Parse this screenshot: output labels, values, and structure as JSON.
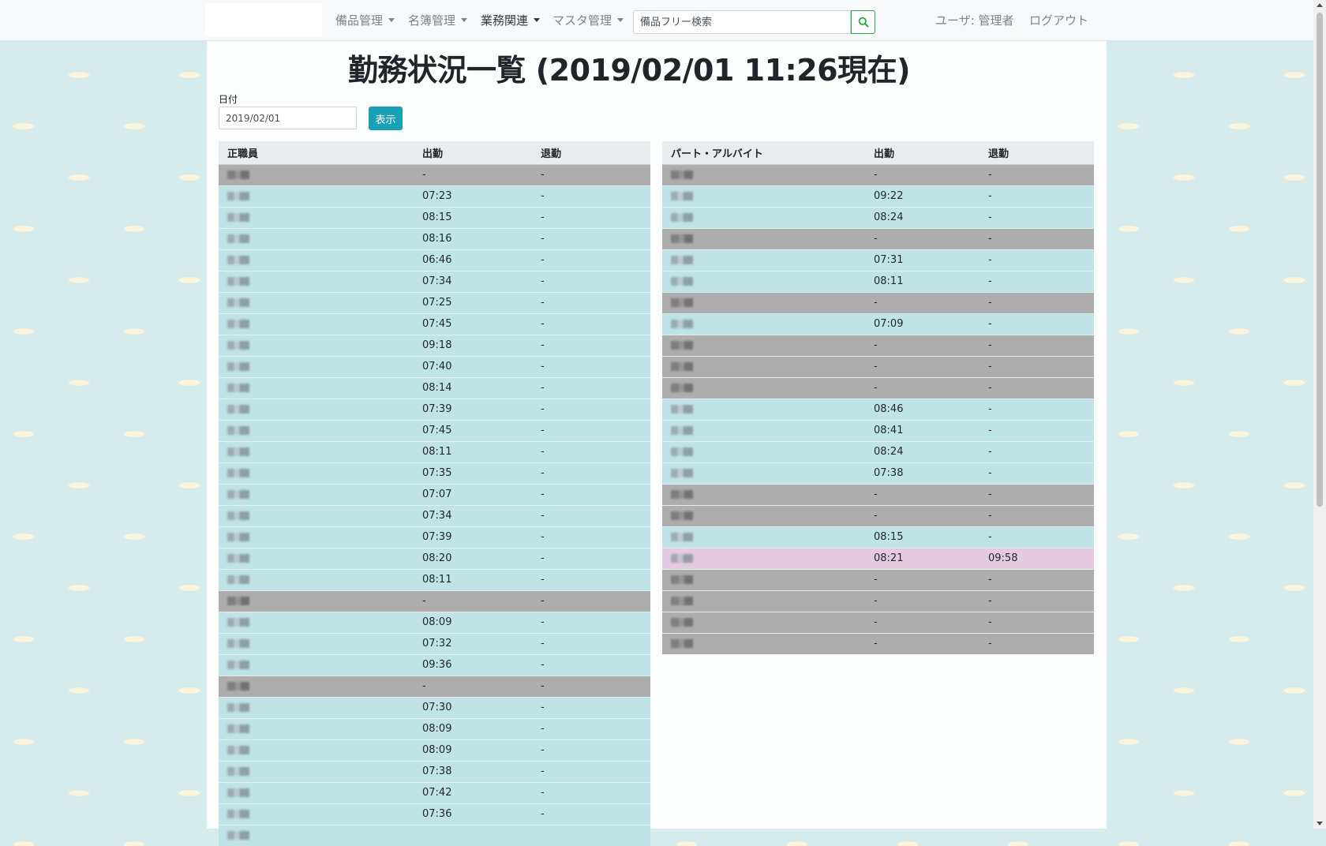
{
  "navbar": {
    "menus": [
      "備品管理",
      "名簿管理",
      "業務関連",
      "マスタ管理"
    ],
    "active_menu": "業務関連",
    "search_placeholder": "備品フリー検索",
    "user": "ユーザ: 管理者",
    "logout": "ログアウト"
  },
  "page": {
    "title": "勤務状況一覧 (2019/02/01 11:26現在)",
    "date_label": "日付",
    "date_value": "2019/02/01",
    "show_button": "表示"
  },
  "colors": {
    "working": "#c0e3e8",
    "absent": "#adadad",
    "left_work": "#e6cae1",
    "button": "#17a2b8"
  },
  "regular": {
    "headers": [
      "正職員",
      "出勤",
      "退勤"
    ],
    "rows": [
      {
        "in": "-",
        "out": "-",
        "status": "absent"
      },
      {
        "in": "07:23",
        "out": "-",
        "status": "in"
      },
      {
        "in": "08:15",
        "out": "-",
        "status": "in"
      },
      {
        "in": "08:16",
        "out": "-",
        "status": "in"
      },
      {
        "in": "06:46",
        "out": "-",
        "status": "in"
      },
      {
        "in": "07:34",
        "out": "-",
        "status": "in"
      },
      {
        "in": "07:25",
        "out": "-",
        "status": "in"
      },
      {
        "in": "07:45",
        "out": "-",
        "status": "in"
      },
      {
        "in": "09:18",
        "out": "-",
        "status": "in"
      },
      {
        "in": "07:40",
        "out": "-",
        "status": "in"
      },
      {
        "in": "08:14",
        "out": "-",
        "status": "in"
      },
      {
        "in": "07:39",
        "out": "-",
        "status": "in"
      },
      {
        "in": "07:45",
        "out": "-",
        "status": "in"
      },
      {
        "in": "08:11",
        "out": "-",
        "status": "in"
      },
      {
        "in": "07:35",
        "out": "-",
        "status": "in"
      },
      {
        "in": "07:07",
        "out": "-",
        "status": "in"
      },
      {
        "in": "07:34",
        "out": "-",
        "status": "in"
      },
      {
        "in": "07:39",
        "out": "-",
        "status": "in"
      },
      {
        "in": "08:20",
        "out": "-",
        "status": "in"
      },
      {
        "in": "08:11",
        "out": "-",
        "status": "in"
      },
      {
        "in": "-",
        "out": "-",
        "status": "absent"
      },
      {
        "in": "08:09",
        "out": "-",
        "status": "in"
      },
      {
        "in": "07:32",
        "out": "-",
        "status": "in"
      },
      {
        "in": "09:36",
        "out": "-",
        "status": "in"
      },
      {
        "in": "-",
        "out": "-",
        "status": "absent"
      },
      {
        "in": "07:30",
        "out": "-",
        "status": "in"
      },
      {
        "in": "08:09",
        "out": "-",
        "status": "in"
      },
      {
        "in": "08:09",
        "out": "-",
        "status": "in"
      },
      {
        "in": "07:38",
        "out": "-",
        "status": "in"
      },
      {
        "in": "07:42",
        "out": "-",
        "status": "in"
      },
      {
        "in": "07:36",
        "out": "-",
        "status": "in"
      },
      {
        "in": "",
        "out": "",
        "status": "in"
      }
    ]
  },
  "part_time": {
    "headers": [
      "パート・アルバイト",
      "出勤",
      "退勤"
    ],
    "rows": [
      {
        "in": "-",
        "out": "-",
        "status": "absent"
      },
      {
        "in": "09:22",
        "out": "-",
        "status": "in"
      },
      {
        "in": "08:24",
        "out": "-",
        "status": "in"
      },
      {
        "in": "-",
        "out": "-",
        "status": "absent"
      },
      {
        "in": "07:31",
        "out": "-",
        "status": "in"
      },
      {
        "in": "08:11",
        "out": "-",
        "status": "in"
      },
      {
        "in": "-",
        "out": "-",
        "status": "absent"
      },
      {
        "in": "07:09",
        "out": "-",
        "status": "in"
      },
      {
        "in": "-",
        "out": "-",
        "status": "absent"
      },
      {
        "in": "-",
        "out": "-",
        "status": "absent"
      },
      {
        "in": "-",
        "out": "-",
        "status": "absent"
      },
      {
        "in": "08:46",
        "out": "-",
        "status": "in"
      },
      {
        "in": "08:41",
        "out": "-",
        "status": "in"
      },
      {
        "in": "08:24",
        "out": "-",
        "status": "in"
      },
      {
        "in": "07:38",
        "out": "-",
        "status": "in"
      },
      {
        "in": "-",
        "out": "-",
        "status": "absent"
      },
      {
        "in": "-",
        "out": "-",
        "status": "absent"
      },
      {
        "in": "08:15",
        "out": "-",
        "status": "in"
      },
      {
        "in": "08:21",
        "out": "09:58",
        "status": "out"
      },
      {
        "in": "-",
        "out": "-",
        "status": "absent"
      },
      {
        "in": "-",
        "out": "-",
        "status": "absent"
      },
      {
        "in": "-",
        "out": "-",
        "status": "absent"
      },
      {
        "in": "-",
        "out": "-",
        "status": "absent"
      }
    ]
  }
}
